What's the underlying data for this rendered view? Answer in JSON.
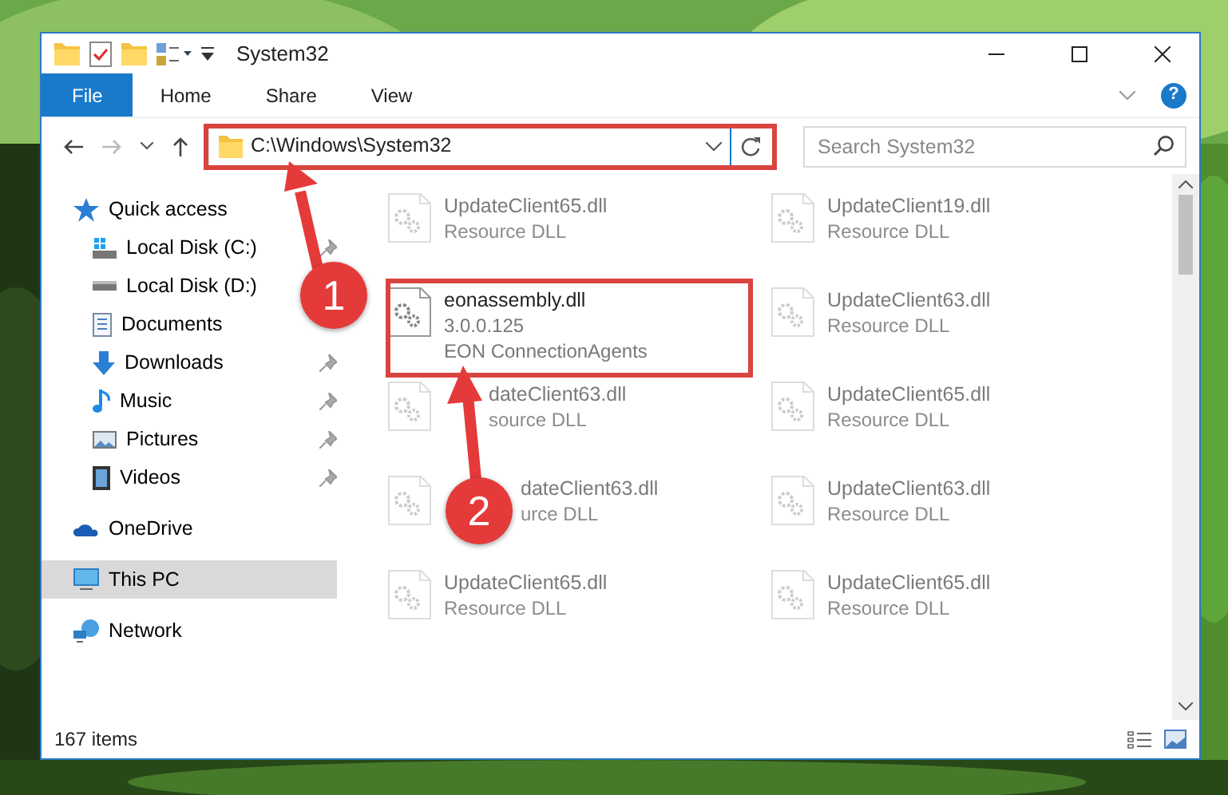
{
  "window": {
    "title": "System32"
  },
  "ribbon_tabs": [
    {
      "label": "File",
      "selected": true
    },
    {
      "label": "Home",
      "selected": false
    },
    {
      "label": "Share",
      "selected": false
    },
    {
      "label": "View",
      "selected": false
    }
  ],
  "help_button": "?",
  "address_bar": {
    "value": "C:\\Windows\\System32"
  },
  "search": {
    "placeholder": "Search System32"
  },
  "sidebar": {
    "items": [
      {
        "label": "Quick access",
        "selected": false,
        "children": [
          {
            "label": "Local Disk (C:)",
            "pinned": true,
            "selected": false
          },
          {
            "label": "Local Disk (D:)",
            "pinned": false,
            "selected": false
          },
          {
            "label": "Documents",
            "pinned": false,
            "selected": false
          },
          {
            "label": "Downloads",
            "pinned": true,
            "selected": false
          },
          {
            "label": "Music",
            "pinned": true,
            "selected": false
          },
          {
            "label": "Pictures",
            "pinned": true,
            "selected": false
          },
          {
            "label": "Videos",
            "pinned": true,
            "selected": false
          }
        ]
      },
      {
        "label": "OneDrive",
        "selected": false
      },
      {
        "label": "This PC",
        "selected": true
      },
      {
        "label": "Network",
        "selected": false
      }
    ]
  },
  "files": [
    {
      "name": "UpdateClient65.dll",
      "lines": [
        "Resource DLL"
      ],
      "faded": true
    },
    {
      "name": "UpdateClient19.dll",
      "lines": [
        "Resource DLL"
      ],
      "faded": true
    },
    {
      "name": "eonassembly.dll",
      "lines": [
        "3.0.0.125",
        "EON ConnectionAgents"
      ],
      "faded": false
    },
    {
      "name": "UpdateClient63.dll",
      "lines": [
        "Resource DLL"
      ],
      "faded": true
    },
    {
      "name": "dateClient63.dll",
      "lines": [
        "source DLL"
      ],
      "faded": true
    },
    {
      "name": "UpdateClient65.dll",
      "lines": [
        "Resource DLL"
      ],
      "faded": true
    },
    {
      "name": "dateClient63.dll",
      "lines": [
        "urce DLL"
      ],
      "faded": true
    },
    {
      "name": "UpdateClient63.dll",
      "lines": [
        "Resource DLL"
      ],
      "faded": true
    },
    {
      "name": "UpdateClient65.dll",
      "lines": [
        "Resource DLL"
      ],
      "faded": true
    },
    {
      "name": "UpdateClient65.dll",
      "lines": [
        "Resource DLL"
      ],
      "faded": true
    }
  ],
  "status_bar": {
    "count": "167 items"
  },
  "annotations": [
    {
      "number": "1"
    },
    {
      "number": "2"
    }
  ]
}
